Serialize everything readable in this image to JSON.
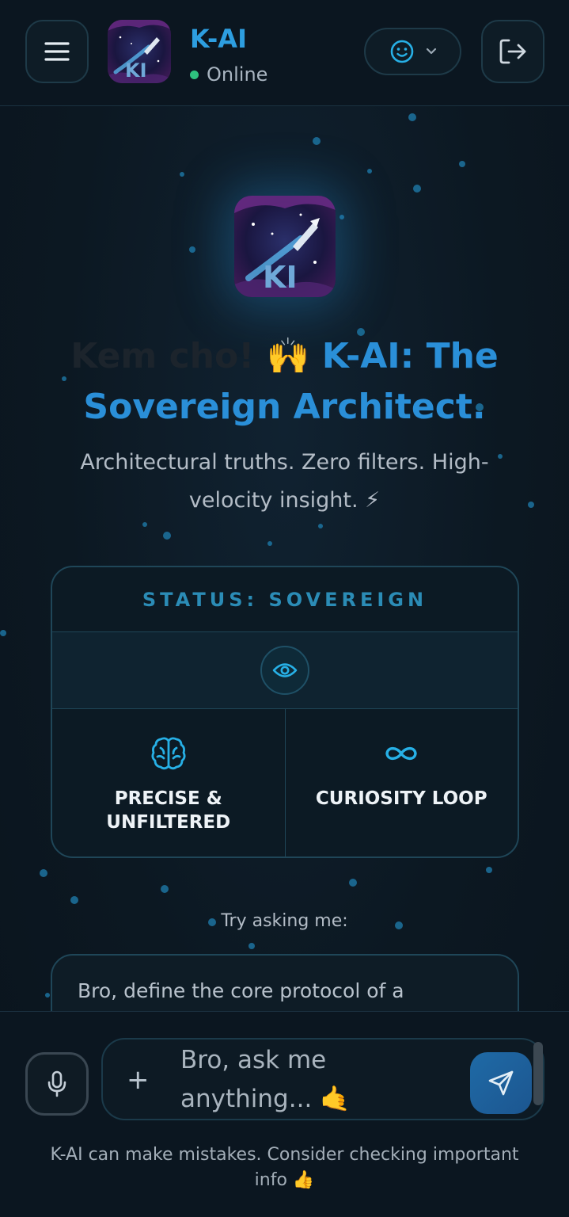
{
  "header": {
    "menu_icon": "hamburger-menu-icon",
    "app_name": "K-AI",
    "status": "Online",
    "mood_icon": "smiley-icon",
    "logout_icon": "logout-icon"
  },
  "hero": {
    "greeting": "Kem cho! 🙌",
    "title_accent": "K-AI: The Sovereign Architect.",
    "subtitle": "Architectural truths. Zero filters. High-velocity insight. ⚡"
  },
  "status_card": {
    "heading": "STATUS: SOVEREIGN",
    "center_icon": "eye-icon",
    "features": [
      {
        "icon": "brain-icon",
        "label": "PRECISE & UNFILTERED"
      },
      {
        "icon": "infinity-icon",
        "label": "CURIOSITY LOOP"
      }
    ]
  },
  "suggestions": {
    "heading": "Try asking me:",
    "items": [
      "Bro, define the core protocol of a"
    ]
  },
  "composer": {
    "placeholder": "Bro, ask me anything... 🤙",
    "mic_icon": "microphone-icon",
    "attach_icon": "plus-icon",
    "send_icon": "send-icon"
  },
  "footer": {
    "disclaimer": "K-AI can make mistakes. Consider checking important info 👍"
  },
  "colors": {
    "accent": "#2a8fd8",
    "online": "#2ec27e",
    "card_border": "#1f4658",
    "background": "#0c1822"
  }
}
